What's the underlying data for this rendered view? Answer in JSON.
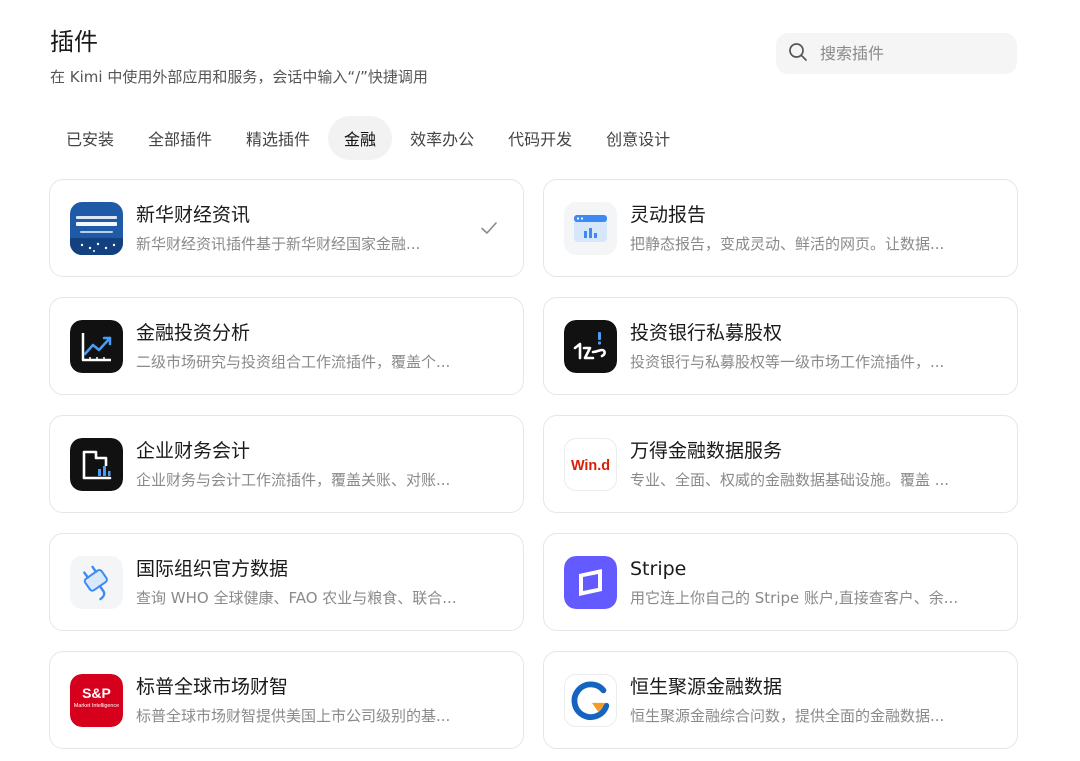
{
  "header": {
    "title": "插件",
    "subtitle": "在 Kimi 中使用外部应用和服务，会话中输入“/”快捷调用"
  },
  "search": {
    "placeholder": "搜索插件",
    "icon": "search-icon"
  },
  "tabs": [
    {
      "label": "已安装",
      "active": false
    },
    {
      "label": "全部插件",
      "active": false
    },
    {
      "label": "精选插件",
      "active": false
    },
    {
      "label": "金融",
      "active": true
    },
    {
      "label": "效率办公",
      "active": false
    },
    {
      "label": "代码开发",
      "active": false
    },
    {
      "label": "创意设计",
      "active": false
    }
  ],
  "plugins": [
    {
      "name": "新华财经资讯",
      "desc": "新华财经资讯插件基于新华财经国家金融...",
      "icon": "xinhua-finance-logo",
      "installed": true
    },
    {
      "name": "灵动报告",
      "desc": "把静态报告，变成灵动、鲜活的网页。让数据...",
      "icon": "report-chart-logo",
      "installed": false
    },
    {
      "name": "金融投资分析",
      "desc": "二级市场研究与投资组合工作流插件，覆盖个...",
      "icon": "trend-chart-logo",
      "installed": false
    },
    {
      "name": "投资银行私募股权",
      "desc": "投资银行与私募股权等一级市场工作流插件，...",
      "icon": "investment-banking-logo",
      "installed": false
    },
    {
      "name": "企业财务会计",
      "desc": "企业财务与会计工作流插件，覆盖关账、对账...",
      "icon": "finance-accounting-logo",
      "installed": false
    },
    {
      "name": "万得金融数据服务",
      "desc": "专业、全面、权威的金融数据基础设施。覆盖 ...",
      "icon": "wind-logo",
      "logo_text": "Win.d",
      "installed": false
    },
    {
      "name": "国际组织官方数据",
      "desc": "查询 WHO 全球健康、FAO 农业与粮食、联合...",
      "icon": "plug-logo",
      "installed": false
    },
    {
      "name": "Stripe",
      "desc": "用它连上你自己的 Stripe 账户,直接查客户、余...",
      "icon": "stripe-logo",
      "installed": false
    },
    {
      "name": "标普全球市场财智",
      "desc": "标普全球市场财智提供美国上市公司级别的基...",
      "icon": "sp-global-logo",
      "logo_text": "S&P",
      "logo_subtext": "Market Intelligence",
      "installed": false
    },
    {
      "name": "恒生聚源金融数据",
      "desc": "恒生聚源金融综合问数，提供全面的金融数据...",
      "icon": "hundsun-logo",
      "installed": false
    }
  ],
  "colors": {
    "stripe": "#635bff",
    "sp_red": "#d6001c",
    "wind_red": "#d81e06",
    "xinhua_blue": "#1f5aa8",
    "hundsun_blue": "#1565c0",
    "hundsun_orange": "#f59a23"
  }
}
